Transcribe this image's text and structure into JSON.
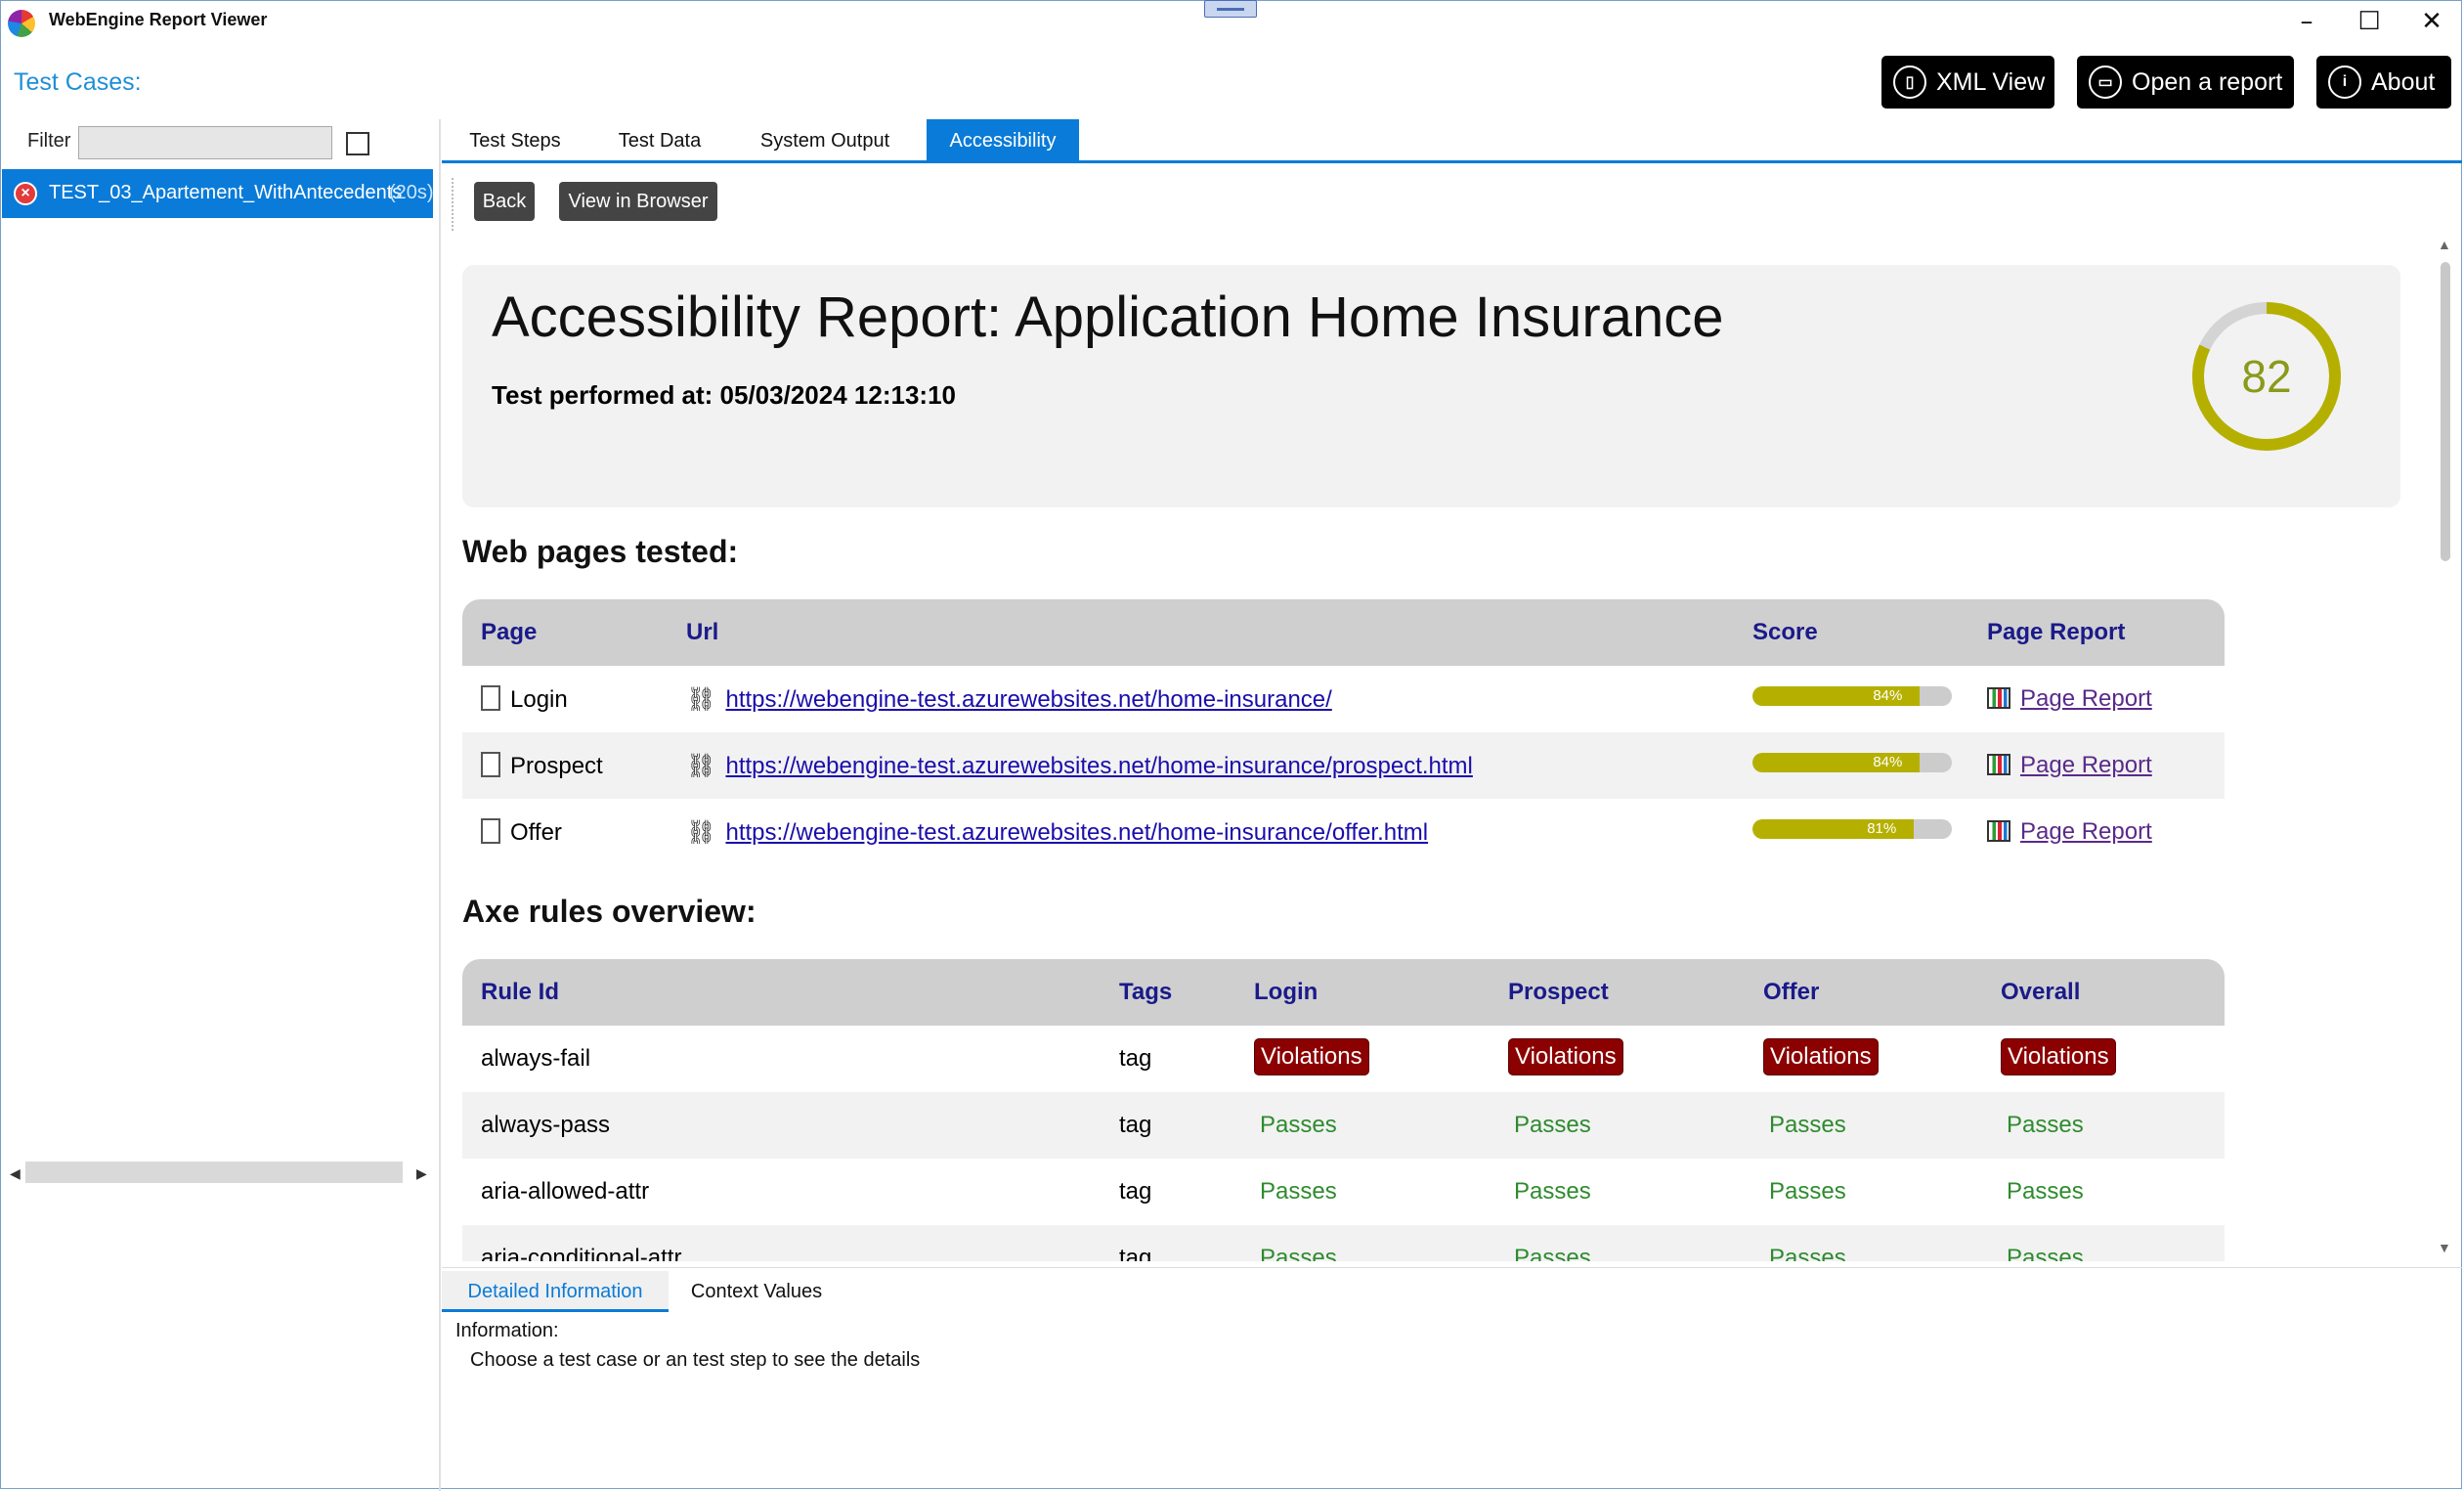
{
  "app": {
    "title": "WebEngine Report Viewer"
  },
  "window": {
    "minimize": "–",
    "maximize": "☐",
    "close": "✕"
  },
  "left_panel": {
    "title": "Test Cases:",
    "filter_label": "Filter",
    "filter_value": "",
    "test_item": {
      "name": "TEST_03_Apartement_WithAntecedents",
      "duration": "(20s)",
      "status": "failed"
    }
  },
  "top_buttons": {
    "xml_view": "XML View",
    "open_report": "Open a report",
    "about": "About"
  },
  "tabs": [
    {
      "label": "Test Steps"
    },
    {
      "label": "Test Data"
    },
    {
      "label": "System Output"
    },
    {
      "label": "Accessibility",
      "active": true
    }
  ],
  "toolbar": {
    "back": "Back",
    "view_in_browser": "View in Browser"
  },
  "report": {
    "title": "Accessibility Report: Application Home Insurance",
    "date": "Test performed at: 05/03/2024 12:13:10",
    "score": "82",
    "score_fraction": 0.82,
    "pages_heading": "Web pages tested:",
    "pages_headers": {
      "page": "Page",
      "url": "Url",
      "score": "Score",
      "report": "Page Report"
    },
    "pages": [
      {
        "name": "Login",
        "url": "https://webengine-test.azurewebsites.net/home-insurance/",
        "score": "84%",
        "fraction": 0.84,
        "report": "Page Report"
      },
      {
        "name": "Prospect",
        "url": "https://webengine-test.azurewebsites.net/home-insurance/prospect.html",
        "score": "84%",
        "fraction": 0.84,
        "report": "Page Report"
      },
      {
        "name": "Offer",
        "url": "https://webengine-test.azurewebsites.net/home-insurance/offer.html",
        "score": "81%",
        "fraction": 0.81,
        "report": "Page Report"
      }
    ],
    "rules_heading": "Axe rules overview:",
    "rules_headers": {
      "rule": "Rule Id",
      "tags": "Tags",
      "login": "Login",
      "prospect": "Prospect",
      "offer": "Offer",
      "overall": "Overall"
    },
    "rules": [
      {
        "id": "always-fail",
        "tag": "tag",
        "login": "Violations",
        "prospect": "Violations",
        "offer": "Violations",
        "overall": "Violations"
      },
      {
        "id": "always-pass",
        "tag": "tag",
        "login": "Passes",
        "prospect": "Passes",
        "offer": "Passes",
        "overall": "Passes"
      },
      {
        "id": "aria-allowed-attr",
        "tag": "tag",
        "login": "Passes",
        "prospect": "Passes",
        "offer": "Passes",
        "overall": "Passes"
      },
      {
        "id": "aria-conditional-attr",
        "tag": "tag",
        "login": "Passes",
        "prospect": "Passes",
        "offer": "Passes",
        "overall": "Passes"
      }
    ]
  },
  "bottom": {
    "tabs": [
      "Detailed Information",
      "Context Values"
    ],
    "info_label": "Information:",
    "info_text": "Choose a test case or an test step to see the details"
  },
  "colors": {
    "accent": "#0a7bd8",
    "violation": "#8b0000",
    "pass": "#2e8b2e",
    "score": "#b5b000"
  }
}
